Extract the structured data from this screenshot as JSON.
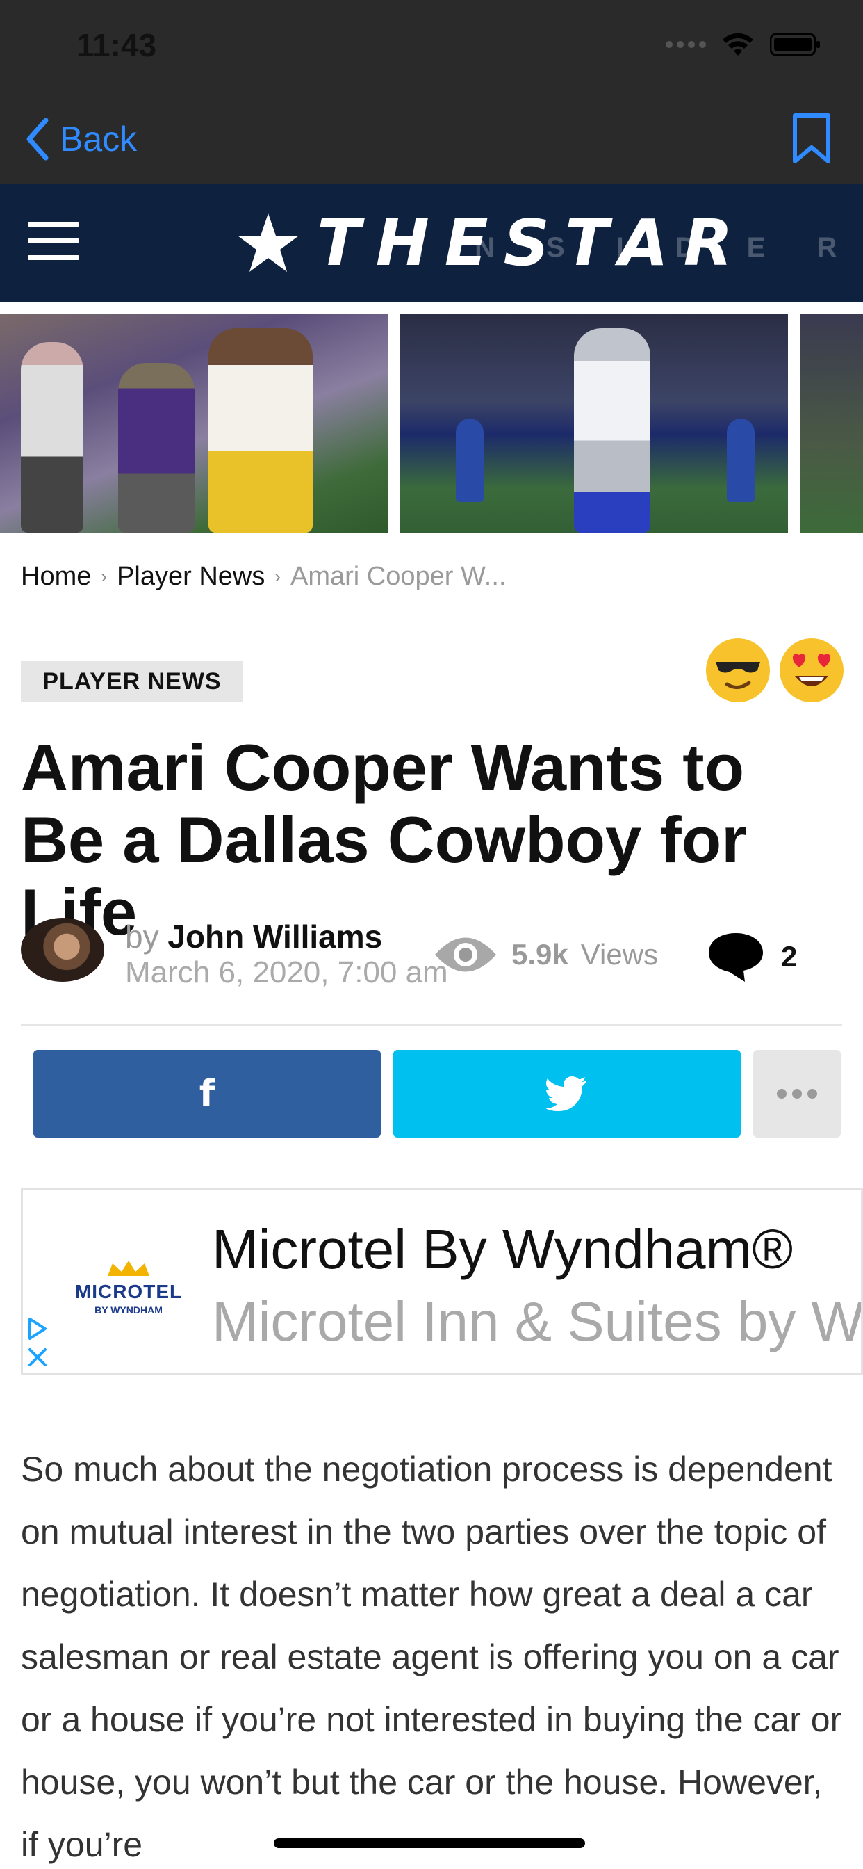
{
  "status_bar": {
    "time": "11:43"
  },
  "nav": {
    "back_label": "Back"
  },
  "site": {
    "logo_text": "THESTAR",
    "logo_sub": "INSIDER"
  },
  "breadcrumb": {
    "items": [
      "Home",
      "Player News",
      "Amari Cooper W..."
    ],
    "separator": "›"
  },
  "article": {
    "category": "PLAYER NEWS",
    "title": "Amari Cooper Wants to Be a Dallas Cowboy for Life",
    "by_prefix": "by",
    "author": "John Williams",
    "date": "March 6, 2020, 7:00 am",
    "views_count": "5.9k",
    "views_label": "Views",
    "comments_count": "2",
    "body": "So much about the negotiation process is dependent on mutual interest in the two parties over the topic of negotiation. It doesn’t matter how great a deal a car salesman or real estate agent is offering you on a car or a house if you’re not interested in buying the car or house, you won’t but the car or the house. However, if you’re"
  },
  "reactions": [
    "sunglasses-emoji",
    "heart-eyes-emoji"
  ],
  "share": {
    "facebook_icon": "f",
    "colors": {
      "facebook": "#2f5f9e",
      "twitter": "#00c0f0",
      "more": "#e6e6e6"
    }
  },
  "ad": {
    "logo_main": "MICROTEL",
    "logo_sub": "BY WYNDHAM",
    "title": "Microtel By Wyndham®",
    "subtitle": "Microtel Inn & Suites by Wyndham"
  },
  "colors": {
    "header_bg": "#0e2240",
    "nav_bg": "#2a2a2a",
    "accent_link": "#2f8bff"
  }
}
